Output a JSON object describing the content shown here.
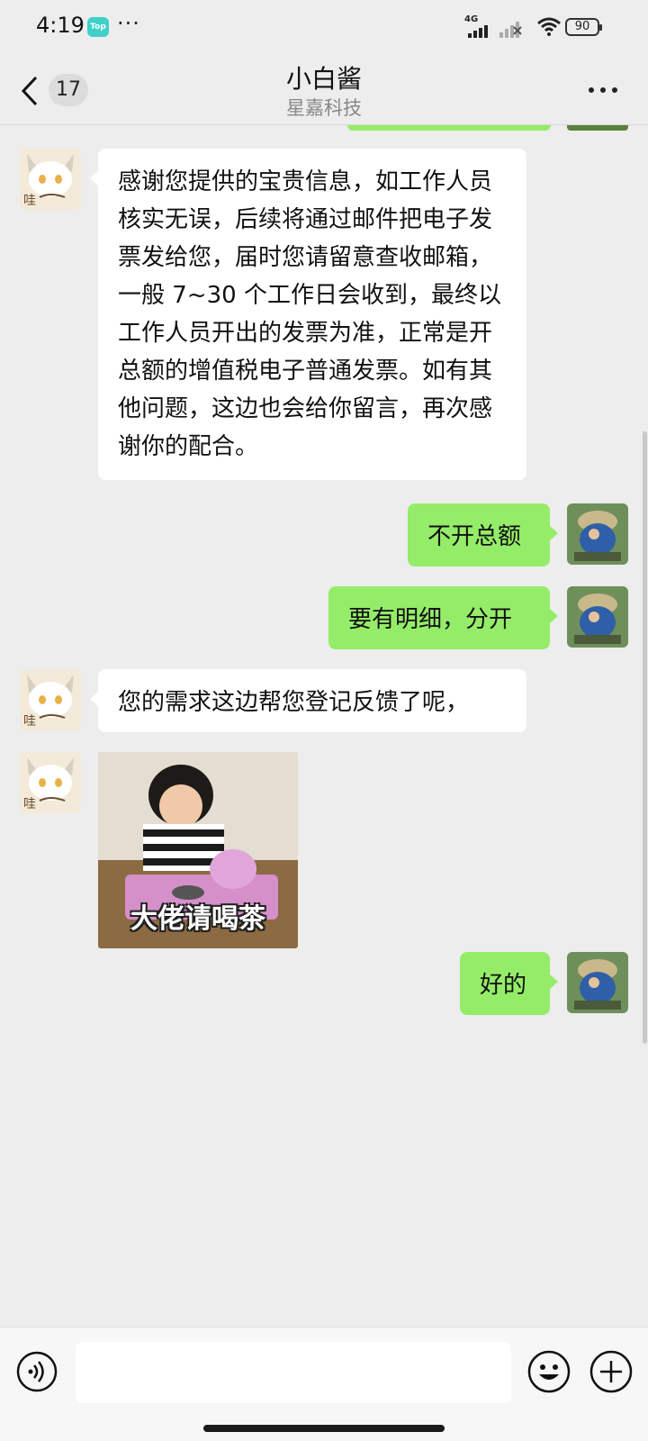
{
  "status_bar": {
    "time": "4:19",
    "app_badge": "Top",
    "more": "···",
    "network": "4G",
    "battery": "90"
  },
  "header": {
    "unread_count": "17",
    "title": "小白酱",
    "subtitle": "星嘉科技"
  },
  "messages": [
    {
      "side": "left",
      "type": "text",
      "text": "感谢您提供的宝贵信息，如工作人员核实无误，后续将通过邮件把电子发票发给您，届时您请留意查收邮箱，一般 7~30 个工作日会收到，最终以工作人员开出的发票为准，正常是开总额的增值税电子普通发票。如有其他问题，这边也会给你留言，再次感谢你的配合。"
    },
    {
      "side": "right",
      "type": "text",
      "text": "不开总额"
    },
    {
      "side": "right",
      "type": "text",
      "text": "要有明细，分开"
    },
    {
      "side": "left",
      "type": "text",
      "text": "您的需求这边帮您登记反馈了呢，"
    },
    {
      "side": "left",
      "type": "sticker",
      "caption": "大佬请喝茶"
    },
    {
      "side": "right",
      "type": "text",
      "text": "好的"
    }
  ],
  "colors": {
    "background": "#ededed",
    "sent_bubble": "#95ec69",
    "received_bubble": "#ffffff"
  },
  "icons": {
    "back": "chevron-left-icon",
    "more": "more-dots-icon",
    "voice": "voice-icon",
    "emoji": "emoji-icon",
    "plus": "plus-icon"
  }
}
